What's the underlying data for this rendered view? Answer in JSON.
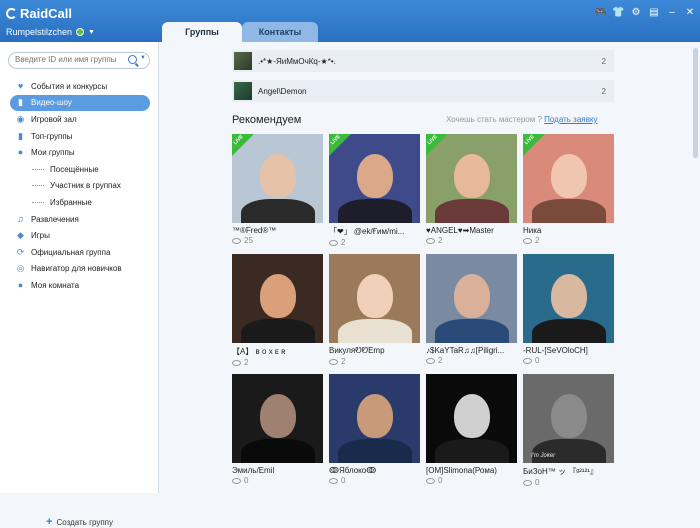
{
  "app": {
    "title": "RaidCall",
    "username": "Rumpelstilzchen"
  },
  "tabs": {
    "groups": "Группы",
    "contacts": "Контакты"
  },
  "search": {
    "placeholder": "Введите ID или имя группы"
  },
  "nav": [
    {
      "label": "События и конкурсы",
      "icon": "heart-icon"
    },
    {
      "label": "Видео-шоу",
      "icon": "video-icon",
      "active": true
    },
    {
      "label": "Игровой зал",
      "icon": "globe-icon"
    },
    {
      "label": "Топ-группы",
      "icon": "chart-icon"
    },
    {
      "label": "Мои группы",
      "icon": "user-icon"
    },
    {
      "label": "Посещённые",
      "sub": true
    },
    {
      "label": "Участник в группах",
      "sub": true
    },
    {
      "label": "Избранные",
      "sub": true
    },
    {
      "label": "Развлечения",
      "icon": "music-icon"
    },
    {
      "label": "Игры",
      "icon": "gamepad-icon"
    },
    {
      "label": "Официальная группа",
      "icon": "refresh-icon"
    },
    {
      "label": "Навигатор для новичков",
      "icon": "compass-icon"
    },
    {
      "label": "Моя комната",
      "icon": "user-icon"
    }
  ],
  "create_group": "Создать группу",
  "groups": [
    {
      "name": ".•*★-ЯиМмОчКq-★*•.",
      "count": "2"
    },
    {
      "name": "Angel\\Demon",
      "count": "2"
    }
  ],
  "recommended": {
    "title": "Рекомендуем",
    "prompt": "Хочешь стать мастером ?",
    "link": "Подать заявку"
  },
  "live_label": "LIVE",
  "cards": [
    {
      "name": "™®Fred®™",
      "views": "25",
      "live": true,
      "bg": "#b9c6d3",
      "skin": "#e6c2a8",
      "cloth": "#2a2a2a"
    },
    {
      "name": "「❤」 @ek/Ғим/mi...",
      "views": "2",
      "live": true,
      "bg": "#3e4a8a",
      "skin": "#d9a98a",
      "cloth": "#1e1e2a"
    },
    {
      "name": "♥ANGEL♥➡Master",
      "views": "2",
      "live": true,
      "bg": "#8aa06a",
      "skin": "#e8b89a",
      "cloth": "#6a3a3a"
    },
    {
      "name": "Ника",
      "views": "2",
      "live": true,
      "bg": "#d98a7a",
      "skin": "#f0c6b0",
      "cloth": "#7a4a3a"
    },
    {
      "name": "【A】 ʙ ᴏ x ᴇ ʀ",
      "views": "2",
      "live": false,
      "bg": "#3a2a22",
      "skin": "#d9a07a",
      "cloth": "#1a1a1a"
    },
    {
      "name": "ВикуляᏬᏬEmp",
      "views": "2",
      "live": false,
      "bg": "#9a7a5a",
      "skin": "#f0d0b8",
      "cloth": "#e8e0d0"
    },
    {
      "name": "♪$KaYTaR♫♫[Piligri...",
      "views": "2",
      "live": false,
      "bg": "#7a8aa0",
      "skin": "#d9b09a",
      "cloth": "#2a4a7a"
    },
    {
      "name": "-RUL-[SeVOloCH]",
      "views": "0",
      "live": false,
      "bg": "#2a6a8a",
      "skin": "#d9b8a0",
      "cloth": "#1a1a1a"
    },
    {
      "name": "Эмиль/Emil",
      "views": "0",
      "live": false,
      "bg": "#1a1a1a",
      "skin": "#a08070",
      "cloth": "#0a0a0a"
    },
    {
      "name": "ↂЯблокоↂ",
      "views": "0",
      "live": false,
      "bg": "#2a3a6a",
      "skin": "#c89a7a",
      "cloth": "#1a2a4a"
    },
    {
      "name": "[OM]Slimona(Рома)",
      "views": "0",
      "live": false,
      "bg": "#0a0a0a",
      "skin": "#d0d0d0",
      "cloth": "#1a1a1a"
    },
    {
      "name": "БиЗоН™ ッ 『ᵍ²¹²¹』",
      "views": "0",
      "live": false,
      "bg": "#6a6a6a",
      "skin": "#8a8a8a",
      "cloth": "#2a2a2a"
    }
  ],
  "card_caption": "I'm Joker"
}
